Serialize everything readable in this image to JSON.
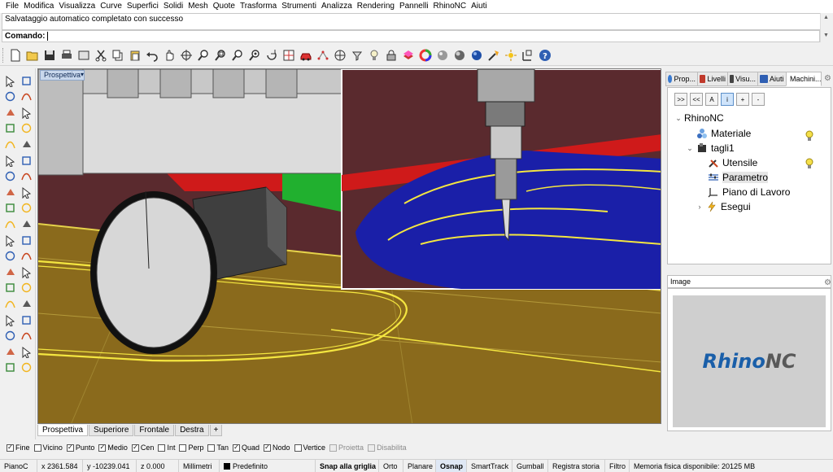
{
  "menu": [
    "File",
    "Modifica",
    "Visualizza",
    "Curve",
    "Superfici",
    "Solidi",
    "Mesh",
    "Quote",
    "Trasforma",
    "Strumenti",
    "Analizza",
    "Rendering",
    "Pannelli",
    "RhinoNC",
    "Aiuti"
  ],
  "history_text": "Salvataggio automatico completato con successo",
  "command_label": "Comando:",
  "command_value": "",
  "viewport": {
    "title": "Prospettiva"
  },
  "viewport_tabs": [
    "Prospettiva",
    "Superiore",
    "Frontale",
    "Destra"
  ],
  "viewport_add_tab": "+",
  "right_tabs": [
    "Prop...",
    "Livelli",
    "Visu...",
    "Aiuti",
    "Machini..."
  ],
  "tree": {
    "root": "RhinoNC",
    "material": "Materiale",
    "cut": "tagli1",
    "tool": "Utensile",
    "param": "Parametro",
    "plane": "Piano di Lavoro",
    "run": "Esegui"
  },
  "machining_toolbar": [
    ">>",
    "<<",
    "A",
    "i",
    "+",
    "-"
  ],
  "image_panel_title": "Image",
  "logo": {
    "part1": "Rhino",
    "part2": "NC"
  },
  "osnaps": [
    {
      "label": "Fine",
      "checked": true
    },
    {
      "label": "Vicino",
      "checked": false
    },
    {
      "label": "Punto",
      "checked": true
    },
    {
      "label": "Medio",
      "checked": true
    },
    {
      "label": "Cen",
      "checked": true
    },
    {
      "label": "Int",
      "checked": false
    },
    {
      "label": "Perp",
      "checked": false
    },
    {
      "label": "Tan",
      "checked": false
    },
    {
      "label": "Quad",
      "checked": true
    },
    {
      "label": "Nodo",
      "checked": true
    },
    {
      "label": "Vertice",
      "checked": false
    },
    {
      "label": "Proietta",
      "checked": false,
      "disabled": true
    },
    {
      "label": "Disabilita",
      "checked": false,
      "disabled": true
    }
  ],
  "status": {
    "plane": "PianoC",
    "x": "x 2361.584",
    "y": "y -10239.041",
    "z": "z 0.000",
    "units": "Millimetri",
    "layer": "Predefinito",
    "snap": "Snap alla griglia",
    "ortho": "Orto",
    "planar": "Planare",
    "osnap": "Osnap",
    "smarttrack": "SmartTrack",
    "gumball": "Gumball",
    "history": "Registra storia",
    "filter": "Filtro",
    "memory": "Memoria fisica disponibile: 20125 MB"
  },
  "colors": {
    "logo_blue": "#1a5fa9",
    "logo_gray": "#595959",
    "stock_blue": "#1a1fa8",
    "toolpath_yellow": "#f4e640",
    "floor": "#8a6a1c",
    "background": "#5a2a2e"
  }
}
